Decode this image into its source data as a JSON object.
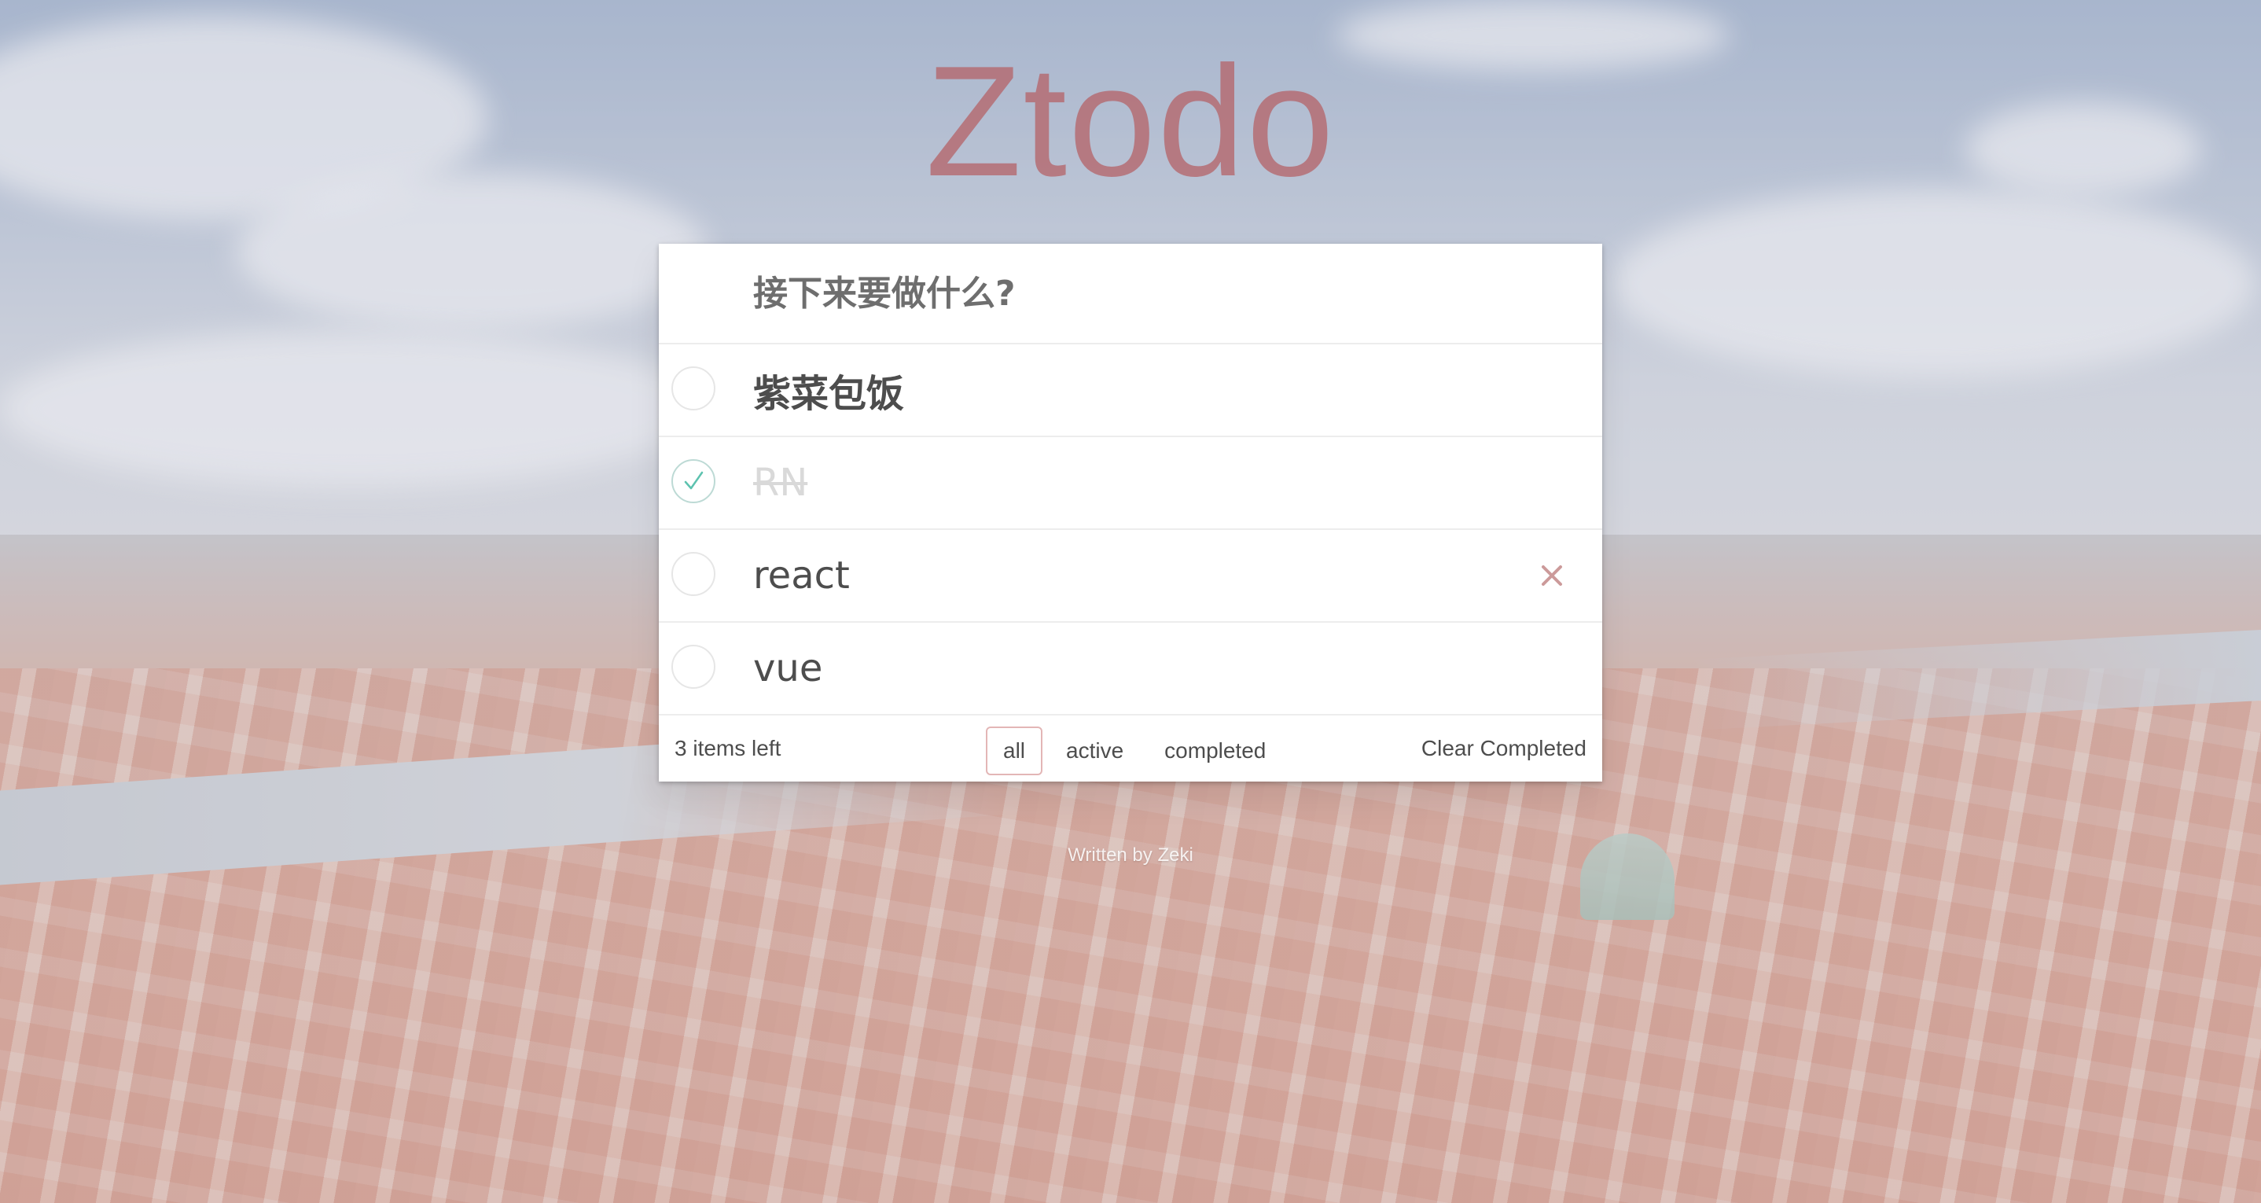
{
  "app": {
    "title": "Ztodo",
    "accent_color": "#b5656a"
  },
  "new_todo": {
    "placeholder": "接下来要做什么?",
    "value": ""
  },
  "todos": [
    {
      "label": "紫菜包饭",
      "completed": false
    },
    {
      "label": "RN",
      "completed": true
    },
    {
      "label": "react",
      "completed": false,
      "hovered": true,
      "delete_icon": "close-icon"
    },
    {
      "label": "vue",
      "completed": false
    }
  ],
  "footer": {
    "items_left": "3 items left",
    "filters": [
      {
        "label": "all",
        "selected": true
      },
      {
        "label": "active",
        "selected": false
      },
      {
        "label": "completed",
        "selected": false
      }
    ],
    "clear_completed": "Clear Completed"
  },
  "credit": "Written by Zeki",
  "colors": {
    "check": "#5dc2af",
    "delete": "#cc9a9a",
    "completed_text": "#d9d9d9"
  }
}
